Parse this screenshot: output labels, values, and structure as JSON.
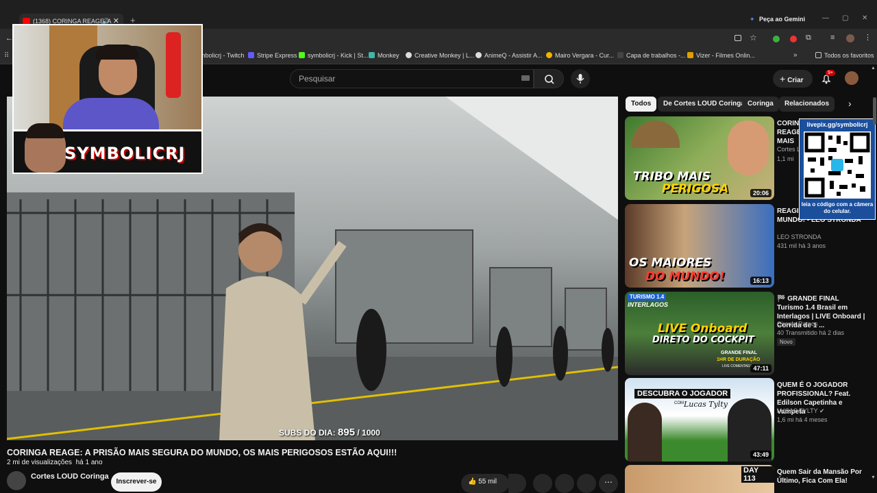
{
  "browser": {
    "tab_title": "(1368) CORINGA REAGE: A",
    "gemini_label": "Peça ao Gemini",
    "bookmarks": [
      {
        "label": "mbolicrj - Twitch",
        "color": "#9146ff"
      },
      {
        "label": "Stripe Express",
        "color": "#635bff"
      },
      {
        "label": "symbolicrj - Kick | St...",
        "color": "#53fc18"
      },
      {
        "label": "Monkey",
        "color": "#3fb6a8"
      },
      {
        "label": "Creative Monkey | L...",
        "color": "#dddddd"
      },
      {
        "label": "AnimeQ - Assistir A...",
        "color": "#dddddd"
      },
      {
        "label": "Mairo Vergara - Cur...",
        "color": "#f0b400"
      },
      {
        "label": "Capa de trabalhos -...",
        "color": "#444444"
      },
      {
        "label": "Vizer - Filmes Onlin...",
        "color": "#e0a000"
      }
    ],
    "all_bookmarks": "Todos os favoritos"
  },
  "header": {
    "search_placeholder": "Pesquisar",
    "create_label": "Criar",
    "notifications_count": "9+"
  },
  "overlay": {
    "streamer_name": "SYMBOLICRJ",
    "livepix_url": "livepix.gg/symbolicrj",
    "qr_caption": "leia o código com a câmera do celular."
  },
  "video": {
    "subs_label": "SUBS DO DIA:",
    "subs_value": "895",
    "subs_goal": "/ 1000",
    "title": "CORINGA REAGE: A PRISÃO MAIS SEGURA DO MUNDO, OS MAIS PERIGOSOS ESTÃO AQUI!!!",
    "views": "2 mi de visualizações",
    "age": "há 1 ano",
    "channel": "Cortes LOUD Coringa",
    "subscribe_label": "Inscrever-se",
    "likes": "55 mil"
  },
  "chips": [
    "Todos",
    "De Cortes LOUD Coringa",
    "Coringa",
    "Relacionados"
  ],
  "recommendations": [
    {
      "title": "CORINGA REAGE: MAIS P... MUNDO",
      "channel": "Cortes L...",
      "meta": "1,1 mi",
      "duration": "20:06",
      "thumb_text": [
        "TRIBO MAIS",
        "PERIGOSA"
      ]
    },
    {
      "title": "REAGIN... COM M... DO MUNDO! - LEO STRONDA",
      "channel": "LEO STRONDA",
      "meta": "431 mil   há 3 anos",
      "duration": "16:13",
      "thumb_text": [
        "OS MAIORES",
        "DO MUNDO!"
      ]
    },
    {
      "title": "🏁 GRANDE FINAL Turismo 1.4 Brasil em Interlagos | LIVE Onboard | Corrida de 1 ...",
      "channel": "Cirenio Ramos",
      "meta": "40   Transmitido há 2 dias",
      "badge": "Novo",
      "duration": "47:11",
      "thumb_text": [
        "LIVE Onboard",
        "DIRETO DO COCKPIT",
        "INTERLAGOS",
        "GRANDE FINAL",
        "1HR DE DURAÇÃO",
        "LIVE COMENTADA",
        "TURISMO 1.4"
      ]
    },
    {
      "title": "QUEM É O JOGADOR PROFISSIONAL? Feat. Edilson Capetinha e Vampeta",
      "channel": "LUCAS TYLTY",
      "meta": "1,6 mi   há 4 meses",
      "duration": "43:49",
      "thumb_text": [
        "DESCUBRA O JOGADOR",
        "Lucas Tylty",
        "COM"
      ]
    },
    {
      "title": "Quem Sair da Mansão Por Último, Fica Com Ela!",
      "thumb_text": [
        "DAY 113"
      ]
    }
  ],
  "colors": {
    "accent": "#ff0000",
    "background": "#0f0f0f"
  }
}
